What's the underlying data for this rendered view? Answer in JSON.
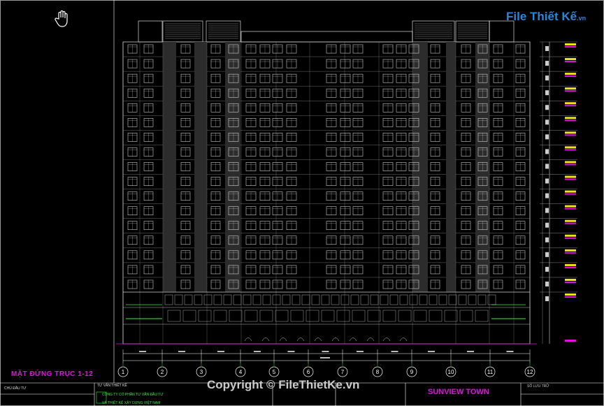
{
  "drawing": {
    "view_title": "MẶT ĐỨNG TRỤC 1-12",
    "grid_labels": [
      "1",
      "2",
      "3",
      "4",
      "5",
      "6",
      "7",
      "8",
      "9",
      "10",
      "11",
      "12"
    ],
    "floors": 17,
    "colors": {
      "outline": "#ffffff",
      "accent_magenta": "#e010e0",
      "accent_green": "#3cf03c",
      "accent_yellow": "#f0e020",
      "grid": "#00ff00",
      "cyan": "#00e0ff"
    }
  },
  "title_block": {
    "investor_label": "CHỦ ĐẦU TƯ",
    "consultant_label": "TƯ VẤN THIẾT KẾ",
    "company_line1": "CÔNG TY CỔ PHẦN TƯ VẤN ĐẦU TƯ",
    "company_line2": "VÀ THIẾT KẾ XÂY DỰNG VIỆT NAM",
    "project_name": "SUNVIEW TOWN",
    "sheet_label": "SỐ LƯU TRỮ"
  },
  "overlay": {
    "watermark": "Copyright © FileThietKe.vn",
    "logo_text": "File Thiết Kế",
    "logo_suffix": ".vn"
  },
  "icons": {
    "cursor": "hand-cursor-icon"
  }
}
